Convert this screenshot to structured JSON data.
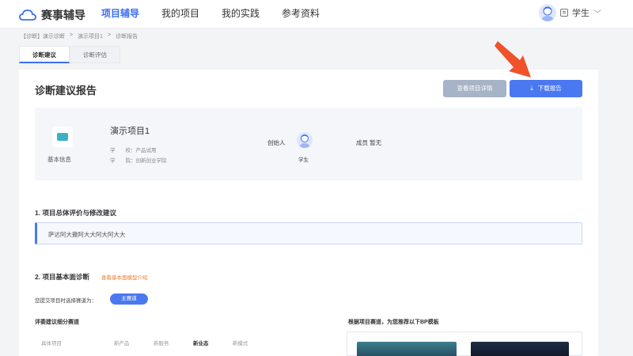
{
  "header": {
    "logo_text": "赛事辅导",
    "nav": [
      "项目辅导",
      "我的项目",
      "我的实践",
      "参考资料"
    ],
    "active_index": 0,
    "user_role": "学生"
  },
  "breadcrumb": [
    "【诊断】演示诊断",
    "演示项目1",
    "诊断报告"
  ],
  "tabs": [
    "诊断建议",
    "诊断评估"
  ],
  "report": {
    "title": "诊断建议报告",
    "view_button": "查看项目详情",
    "download_button": "下载报告"
  },
  "info": {
    "basic_label": "基本信息",
    "project_name": "演示项目1",
    "school": "学　　校：产品试用",
    "college": "学　　院：创新创业学院",
    "creator_label": "创始人",
    "creator_role": "学生",
    "member_label": "成员  暂无"
  },
  "section1": {
    "title": "1. 项目总体评价与修改建议",
    "content": "萨达阿大撒阿大大阿大阿大大"
  },
  "section2": {
    "title": "2. 项目基本面诊断",
    "link": "查看基本面模型介绍",
    "track_label": "您提交项目时选择赛道为：",
    "track_value": "主赛道",
    "left_subtitle": "评委建议细分赛道",
    "right_subtitle": "根据项目赛道，为您推荐以下BP模板",
    "grid_headers": [
      "具体项目",
      "新产品",
      "新服务",
      "新业态",
      "新模式"
    ]
  },
  "colors": {
    "primary": "#4a78f0",
    "annotation_arrow": "#f0522a",
    "link_orange": "#f27a2b"
  }
}
